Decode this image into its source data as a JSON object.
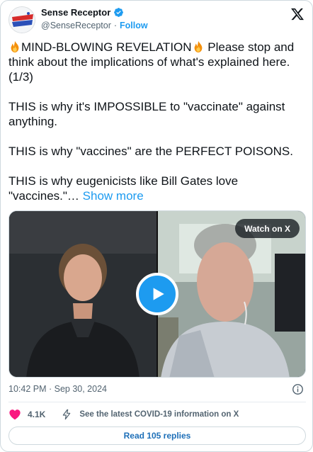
{
  "author": {
    "display_name": "Sense Receptor",
    "handle": "@SenseReceptor",
    "separator": "·",
    "follow_label": "Follow",
    "verified": true,
    "avatar_text": "SENSE RECEPTOR"
  },
  "tweet": {
    "line1_head": "MIND-BLOWING REVELATION",
    "line1_tail": " Please stop and think about the implications of what's explained here. (1/3)",
    "para2": "THIS is why it's IMPOSSIBLE to \"vaccinate\" against anything.",
    "para3": "THIS is why \"vaccines\" are the PERFECT POISONS.",
    "para4": "THIS is why eugenicists like Bill Gates love \"vaccines.\"…",
    "show_more": "Show more",
    "emoji": "fire-icon"
  },
  "media": {
    "watch_label": "Watch on X",
    "play_icon": "play-icon"
  },
  "timestamp": "10:42 PM · Sep 30, 2024",
  "engagement": {
    "like_count": "4.1K",
    "covid_notice": "See the latest COVID-19 information on X"
  },
  "replies_button": "Read 105 replies",
  "colors": {
    "accent": "#1d9bf0",
    "like": "#f91880",
    "text": "#0f1419",
    "muted": "#536471",
    "border": "#cfd9de"
  }
}
